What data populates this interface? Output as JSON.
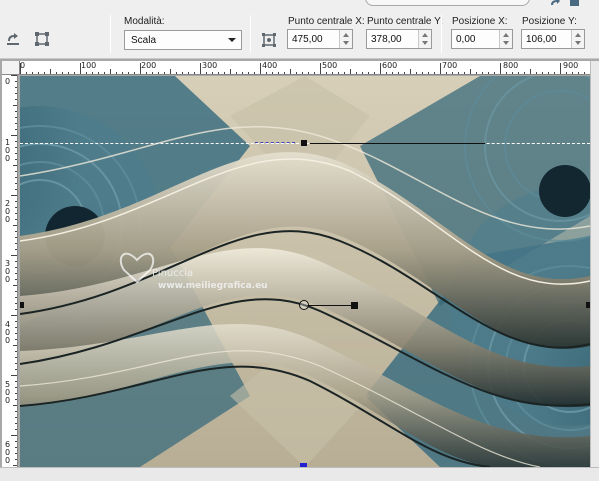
{
  "toolbar": {
    "modalita_label": "Modalità:",
    "modalita_value": "Scala",
    "punto_x_label": "Punto centrale X:",
    "punto_x_value": "475,00",
    "punto_y_label": "Punto centrale Y:",
    "punto_y_value": "378,00",
    "pos_x_label": "Posizione X:",
    "pos_x_value": "0,00",
    "pos_y_label": "Posizione Y:",
    "pos_y_value": "106,00"
  },
  "ruler": {
    "h_ticks": [
      "0",
      "100",
      "200",
      "300",
      "400",
      "500",
      "600",
      "700",
      "800",
      "900"
    ],
    "v_ticks": [
      "0",
      "100",
      "200",
      "300",
      "400",
      "500",
      "600"
    ]
  },
  "watermark": {
    "name": "Pinuccia",
    "site": "www.meiliegrafica.eu"
  },
  "colors": {
    "teal": "#2e5f70",
    "beige": "#c9c2ac",
    "toolbar": "#efefef"
  }
}
